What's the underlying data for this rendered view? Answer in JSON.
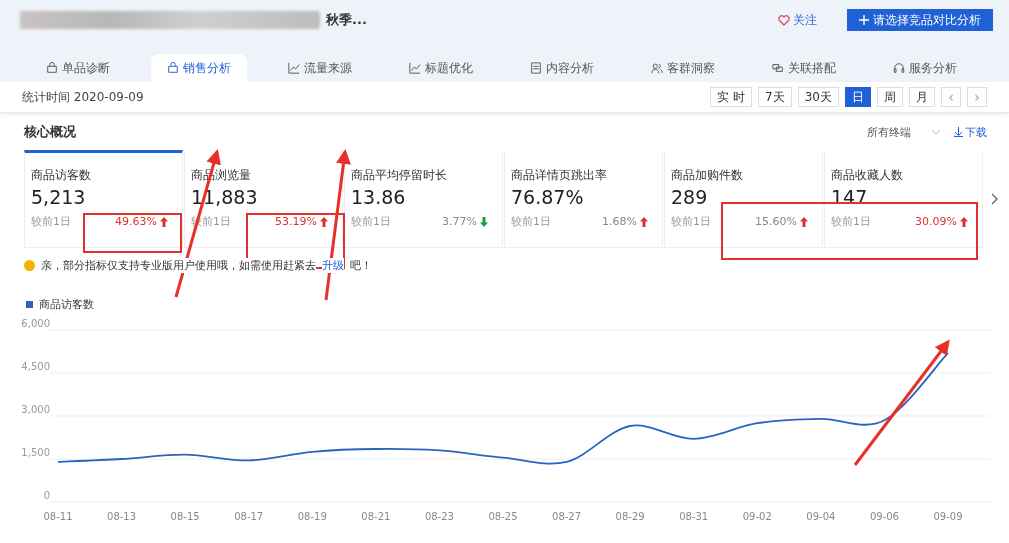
{
  "header": {
    "product_title": "秋季...",
    "follow_label": "关注",
    "compare_button": "请选择竞品对比分析"
  },
  "tabs": [
    {
      "label": "单品诊断",
      "selected": false
    },
    {
      "label": "销售分析",
      "selected": true
    },
    {
      "label": "流量来源",
      "selected": false
    },
    {
      "label": "标题优化",
      "selected": false
    },
    {
      "label": "内容分析",
      "selected": false
    },
    {
      "label": "客群洞察",
      "selected": false
    },
    {
      "label": "关联搭配",
      "selected": false
    },
    {
      "label": "服务分析",
      "selected": false
    }
  ],
  "stats_time": "统计时间 2020-09-09",
  "period_buttons": [
    {
      "label": "实 时",
      "selected": false
    },
    {
      "label": "7天",
      "selected": false
    },
    {
      "label": "30天",
      "selected": false
    },
    {
      "label": "日",
      "selected": true
    },
    {
      "label": "周",
      "selected": false
    },
    {
      "label": "月",
      "selected": false
    }
  ],
  "pager": {
    "prev": "‹",
    "next": "›"
  },
  "section": {
    "title": "核心概况",
    "terminal_select": "所有终端",
    "download": "下载"
  },
  "metrics": [
    {
      "label": "商品访客数",
      "value": "5,213",
      "compare": "较前1日",
      "change": "49.63%",
      "increase": true,
      "emphasized": true,
      "selected": true
    },
    {
      "label": "商品浏览量",
      "value": "11,883",
      "compare": "较前1日",
      "change": "53.19%",
      "increase": true,
      "emphasized": true,
      "selected": false
    },
    {
      "label": "商品平均停留时长",
      "value": "13.86",
      "compare": "较前1日",
      "change": "3.77%",
      "increase": false,
      "emphasized": false,
      "selected": false
    },
    {
      "label": "商品详情页跳出率",
      "value": "76.87%",
      "compare": "较前1日",
      "change": "1.68%",
      "increase": true,
      "emphasized": false,
      "selected": false
    },
    {
      "label": "商品加购件数",
      "value": "289",
      "compare": "较前1日",
      "change": "15.60%",
      "increase": true,
      "emphasized": false,
      "selected": false
    },
    {
      "label": "商品收藏人数",
      "value": "147",
      "compare": "较前1日",
      "change": "30.09%",
      "increase": true,
      "emphasized": true,
      "selected": false
    }
  ],
  "notice": {
    "text": "亲，部分指标仅支持专业版用户使用哦，如需使用赶紧去",
    "link": "升级",
    "suffix": "吧！"
  },
  "chart": {
    "chart_data": {
      "type": "line",
      "x": [
        "08-11",
        "08-13",
        "08-15",
        "08-17",
        "08-19",
        "08-21",
        "08-23",
        "08-25",
        "08-27",
        "08-29",
        "08-31",
        "09-02",
        "09-04",
        "09-06",
        "09-09"
      ],
      "series": [
        {
          "name": "商品访客数",
          "color": "#2b62c4",
          "values": [
            1400,
            1500,
            1650,
            1450,
            1750,
            1850,
            1800,
            1550,
            1400,
            2650,
            2200,
            2750,
            2900,
            2850,
            5200
          ]
        }
      ],
      "ylim": [
        0,
        6000
      ],
      "yticks": [
        {
          "value": 0,
          "label": "0"
        },
        {
          "value": 1500,
          "label": "1,500"
        },
        {
          "value": 3000,
          "label": "3,000"
        },
        {
          "value": 4500,
          "label": "4,500"
        },
        {
          "value": 6000,
          "label": "6,000"
        }
      ],
      "grid": true
    }
  }
}
